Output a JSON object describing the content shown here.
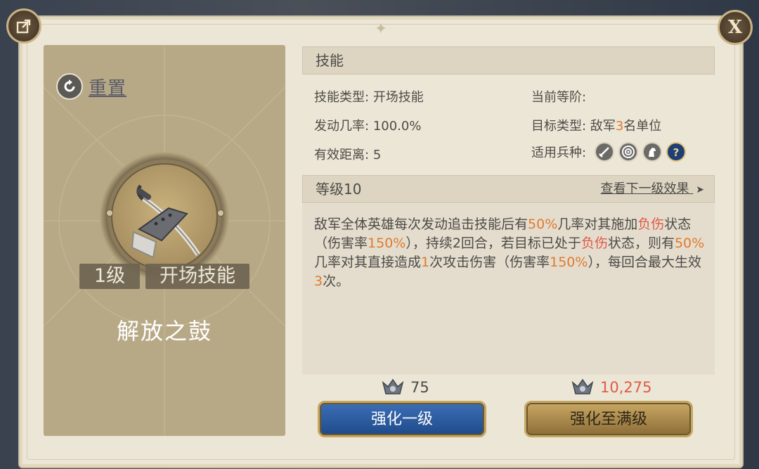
{
  "panel": {
    "share_icon": "share-icon",
    "close_icon": "close-icon",
    "close_label": "X"
  },
  "card": {
    "reset_label": "重置",
    "level_tag": "1级",
    "type_tag": "开场技能",
    "skill_name": "解放之鼓",
    "skill_icon": "sword-and-drum-icon"
  },
  "skill_section": {
    "header": "技能",
    "skill_type_label": "技能类型:",
    "skill_type_value": "开场技能",
    "current_tier_label": "当前等阶:",
    "trigger_rate_label": "发动几率:",
    "trigger_rate_value": "100.0%",
    "target_type_label": "目标类型:",
    "target_type_prefix": "敌军",
    "target_type_count": "3",
    "target_type_suffix": "名单位",
    "range_label": "有效距离:",
    "range_value": "5",
    "unit_types_label": "适用兵种:",
    "unit_types": [
      "sword-icon",
      "archery-target-icon",
      "horse-icon",
      "question-icon"
    ]
  },
  "level_section": {
    "header": "等级10",
    "next_link": "查看下一级效果",
    "next_arrow": "➤"
  },
  "description": {
    "p1": "敌军全体英雄每次发动追击技能后有",
    "v1": "50%",
    "p2": "几率对其施加",
    "d1": "负伤",
    "p3": "状态（伤害率",
    "v2": "150%",
    "p4": "），持续2回合，若目标已处于",
    "d2": "负伤",
    "p5": "状态，则有",
    "v3": "50%",
    "p6": "几率对其直接造成",
    "v4": "1",
    "p7": "次攻击伤害（伤害率",
    "v5": "150%",
    "p8": "），每回合最大生效",
    "v6": "3",
    "p9": "次。"
  },
  "upgrade": {
    "cost_icon": "medal-icon",
    "single_cost": "75",
    "max_cost": "10,275",
    "single_button": "强化一级",
    "max_button": "强化至满级"
  },
  "colors": {
    "highlight": "#e07a2e",
    "debuff": "#e05a4a",
    "cost_insufficient": "#e05a4a"
  }
}
